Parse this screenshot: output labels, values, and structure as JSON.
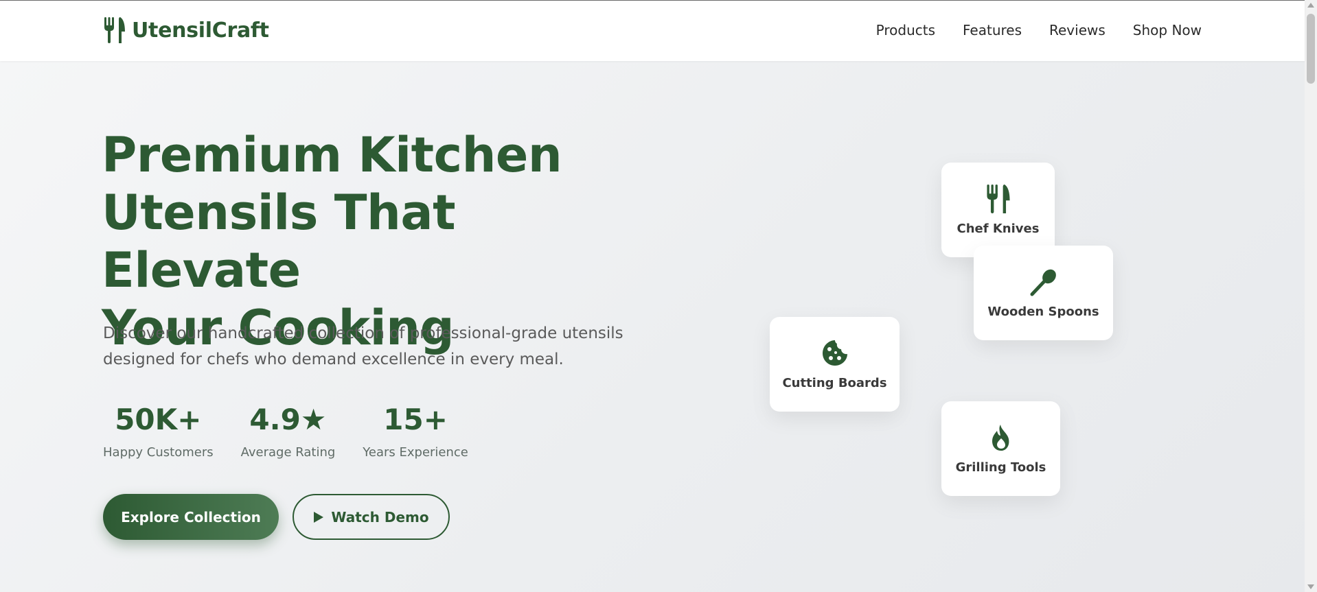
{
  "brand": {
    "name": "UtensilCraft",
    "icon": "utensils-icon",
    "color": "#2d5a33"
  },
  "nav": {
    "items": [
      "Products",
      "Features",
      "Reviews",
      "Shop Now"
    ]
  },
  "hero": {
    "title_lines": [
      "Premium Kitchen",
      "Utensils That Elevate",
      "Your Cooking"
    ],
    "subtitle_lines": [
      "Discover our handcrafted collection of professional-grade utensils",
      "designed for chefs who demand excellence in every meal."
    ],
    "stats": [
      {
        "value": "50K+",
        "label": "Happy Customers"
      },
      {
        "value": "4.9★",
        "label": "Average Rating"
      },
      {
        "value": "15+",
        "label": "Years Experience"
      }
    ],
    "buttons": {
      "primary": "Explore Collection",
      "secondary": "Watch Demo",
      "secondary_icon": "play-icon"
    }
  },
  "cards": [
    {
      "label": "Chef Knives",
      "icon": "utensils-icon"
    },
    {
      "label": "Wooden Spoons",
      "icon": "spoon-icon"
    },
    {
      "label": "Cutting Boards",
      "icon": "cookie-icon"
    },
    {
      "label": "Grilling Tools",
      "icon": "fire-icon"
    }
  ],
  "colors": {
    "accent": "#2d5a33",
    "accent_light": "#4e7c55",
    "text": "#2a2a2a",
    "muted": "#5a5a5a"
  }
}
